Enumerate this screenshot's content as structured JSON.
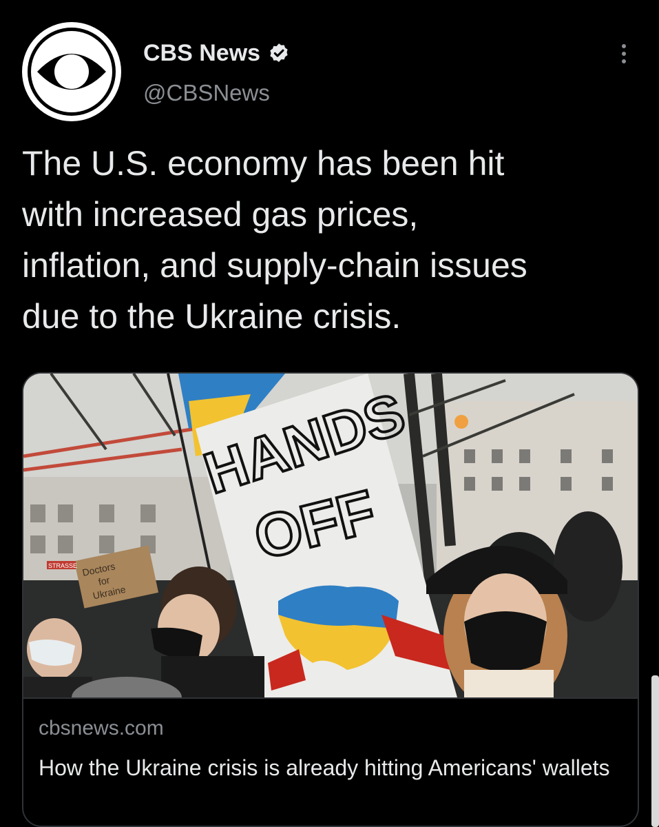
{
  "tweet": {
    "author": {
      "name": "CBS News",
      "handle": "@CBSNews",
      "verified": true,
      "avatar_icon": "cbs-eye-logo-icon",
      "verified_icon": "verified-badge-icon"
    },
    "more_icon": "more-options-icon",
    "text": "The U.S. economy has been hit\nwith increased gas prices,\ninflation, and supply-chain issues\ndue to the Ukraine crisis.",
    "card": {
      "domain": "cbsnews.com",
      "title": "How the Ukraine crisis is already hitting Americans' wallets",
      "image": {
        "sign_line_1": "HANDS",
        "sign_line_2": "OFF",
        "small_sign_line_1": "Doctors",
        "small_sign_line_2": "for",
        "small_sign_line_3": "Ukraine",
        "street_sign": "STRASSE"
      }
    }
  },
  "colors": {
    "background": "#000000",
    "primary_text": "#e7e9ea",
    "secondary_text": "#8b8f94",
    "border": "#2f3336",
    "ukraine_blue": "#2f7fc4",
    "ukraine_yellow": "#f2c230",
    "russia_red": "#c8281e"
  }
}
